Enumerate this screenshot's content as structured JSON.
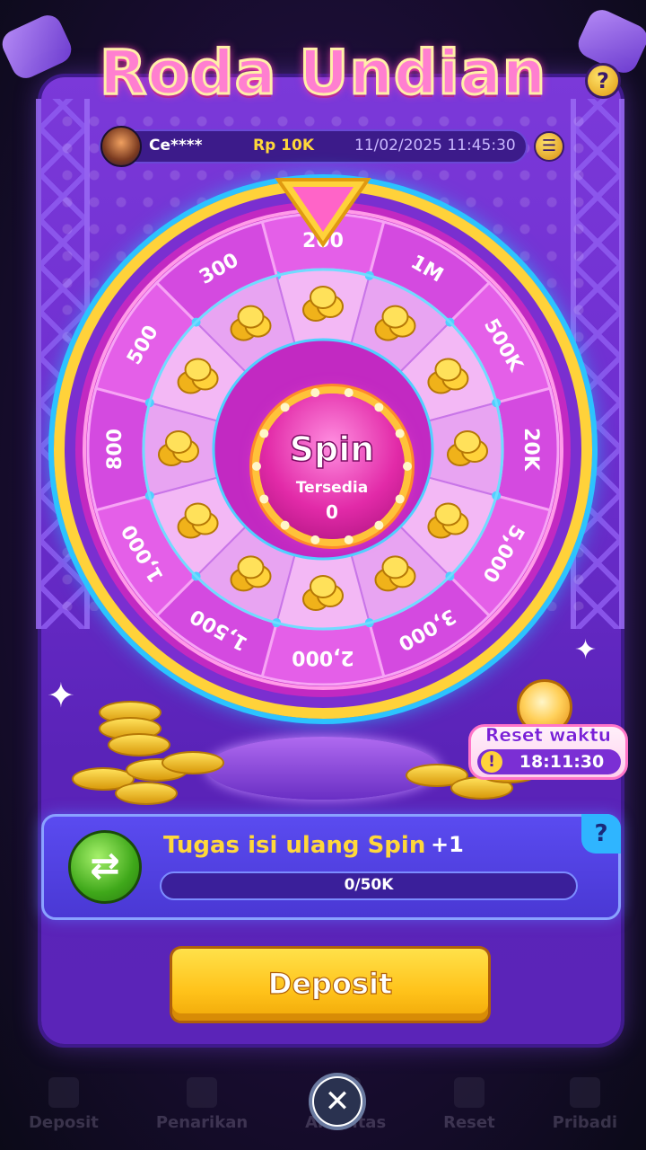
{
  "title": "Roda Undian",
  "user": {
    "name": "Ce****",
    "balance": "Rp 10K",
    "datetime": "11/02/2025 11:45:30"
  },
  "wheel": {
    "segments": [
      "200",
      "1M",
      "500K",
      "20K",
      "5,000",
      "3,000",
      "2,000",
      "1,500",
      "1,000",
      "800",
      "500",
      "300"
    ],
    "spin_label": "Spin",
    "available_label": "Tersedia",
    "available_count": "0"
  },
  "reset": {
    "label": "Reset waktu",
    "time": "18:11:30"
  },
  "task": {
    "title": "Tugas isi ulang  Spin",
    "bonus": "+1",
    "progress_text": "0/50K",
    "progress_fraction": 0,
    "help": "?"
  },
  "buttons": {
    "help_top": "?",
    "deposit": "Deposit",
    "close": "✕",
    "list": "☰"
  },
  "bottom_nav": [
    {
      "label": "Deposit"
    },
    {
      "label": "Penarikan"
    },
    {
      "label": "Aktivitas"
    },
    {
      "label": "Reset"
    },
    {
      "label": "Pribadi"
    }
  ]
}
